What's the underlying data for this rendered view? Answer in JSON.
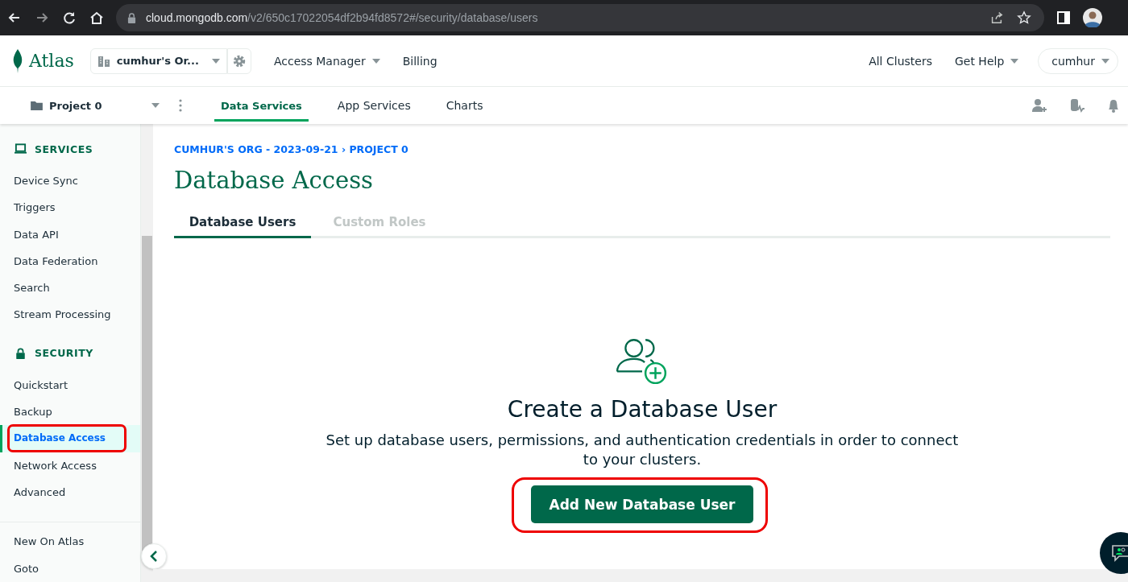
{
  "browser": {
    "url_host": "cloud.mongodb.com",
    "url_path": "/v2/650c17022054df2b94fd8572#/security/database/users"
  },
  "topnav": {
    "logo": "Atlas",
    "org": "cumhur's Or...",
    "links": [
      {
        "label": "Access Manager",
        "dropdown": true
      },
      {
        "label": "Billing",
        "dropdown": false
      }
    ],
    "right": [
      {
        "label": "All Clusters",
        "dropdown": false
      },
      {
        "label": "Get Help",
        "dropdown": true
      }
    ],
    "user": "cumhur"
  },
  "subnav": {
    "project": "Project 0",
    "tabs": [
      {
        "label": "Data Services",
        "selected": true
      },
      {
        "label": "App Services",
        "selected": false
      },
      {
        "label": "Charts",
        "selected": false
      }
    ]
  },
  "sidebar": {
    "sections": [
      {
        "title": "SERVICES",
        "kind": "services",
        "items": [
          {
            "label": "Device Sync",
            "selected": false
          },
          {
            "label": "Triggers",
            "selected": false
          },
          {
            "label": "Data API",
            "selected": false
          },
          {
            "label": "Data Federation",
            "selected": false
          },
          {
            "label": "Search",
            "selected": false
          },
          {
            "label": "Stream Processing",
            "selected": false
          }
        ]
      },
      {
        "title": "SECURITY",
        "kind": "security",
        "items": [
          {
            "label": "Quickstart",
            "selected": false
          },
          {
            "label": "Backup",
            "selected": false
          },
          {
            "label": "Database Access",
            "selected": true,
            "highlighted": true
          },
          {
            "label": "Network Access",
            "selected": false
          },
          {
            "label": "Advanced",
            "selected": false
          }
        ]
      }
    ],
    "footer": [
      "New On Atlas",
      "Goto"
    ]
  },
  "breadcrumb": "CUMHUR'S ORG - 2023-09-21 › PROJECT 0",
  "title": "Database Access",
  "tabs": [
    {
      "label": "Database Users",
      "selected": true
    },
    {
      "label": "Custom Roles",
      "selected": false
    }
  ],
  "empty_state": {
    "heading": "Create a Database User",
    "description": "Set up database users, permissions, and authentication credentials in order to connect to your clusters.",
    "button": "Add New Database User",
    "button_highlighted": true
  }
}
